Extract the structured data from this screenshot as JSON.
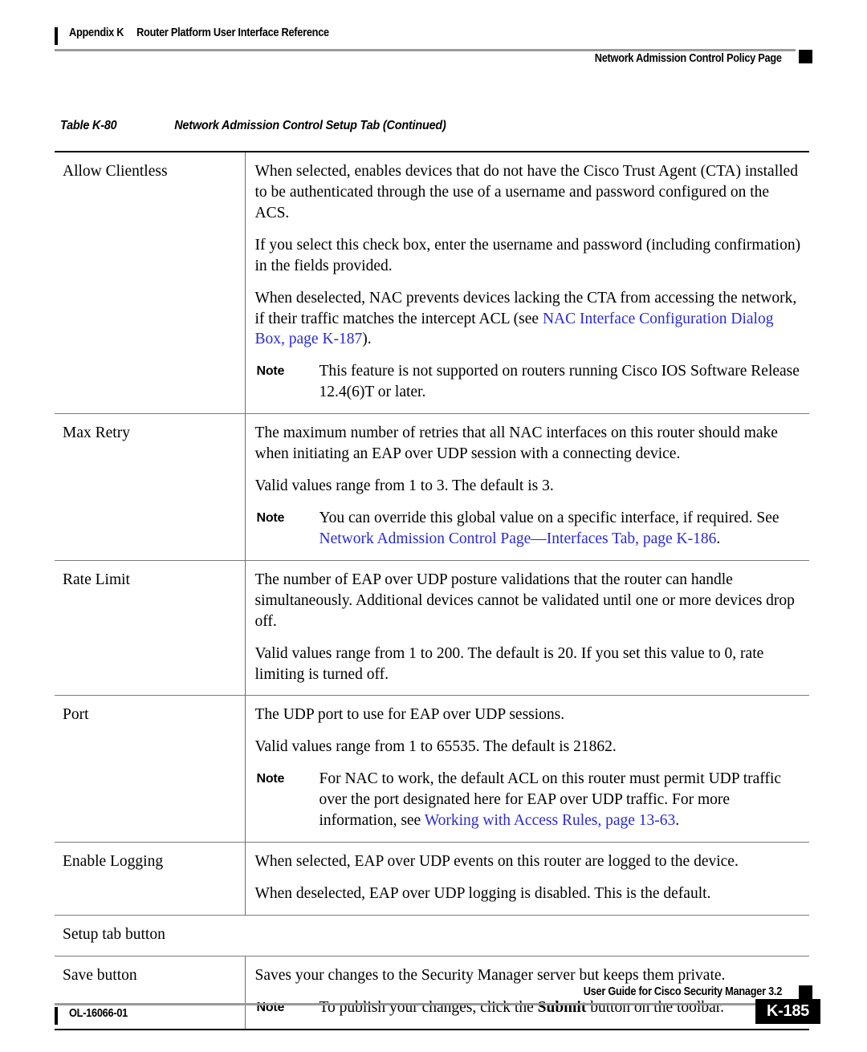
{
  "header": {
    "appendix": "Appendix K",
    "appendix_title": "Router Platform User Interface Reference",
    "section": "Network Admission Control Policy Page"
  },
  "table": {
    "caption_number": "Table K-80",
    "caption_title": "Network Admission Control Setup Tab (Continued)",
    "note_label": "Note",
    "rows": [
      {
        "name": "Allow Clientless",
        "paragraphs": [
          "When selected, enables devices that do not have the Cisco Trust Agent (CTA) installed to be authenticated through the use of a username and password configured on the ACS.",
          "If you select this check box, enter the username and password (including confirmation) in the fields provided.",
          "When deselected, NAC prevents devices lacking the CTA from accessing the network, if their traffic matches the intercept ACL (see "
        ],
        "link_text": "NAC Interface Configuration Dialog Box, page K-187",
        "link_tail": ").",
        "note": "This feature is not supported on routers running Cisco IOS Software Release 12.4(6)T or later."
      },
      {
        "name": "Max Retry",
        "paragraphs": [
          "The maximum number of retries that all NAC interfaces on this router should make when initiating an EAP over UDP session with a connecting device.",
          "Valid values range from 1 to 3. The default is 3."
        ],
        "note_lead": "You can override this global value on a specific interface, if required. See ",
        "note_link": "Network Admission Control Page—Interfaces Tab, page K-186",
        "note_tail": "."
      },
      {
        "name": "Rate Limit",
        "paragraphs": [
          "The number of EAP over UDP posture validations that the router can handle simultaneously. Additional devices cannot be validated until one or more devices drop off.",
          "Valid values range from 1 to 200. The default is 20. If you set this value to 0, rate limiting is turned off."
        ]
      },
      {
        "name": "Port",
        "paragraphs": [
          "The UDP port to use for EAP over UDP sessions.",
          "Valid values range from 1 to 65535. The default is 21862."
        ],
        "note_lead": "For NAC to work, the default ACL on this router must permit UDP traffic over the port designated here for EAP over UDP traffic. For more information, see ",
        "note_link": "Working with Access Rules, page 13-63",
        "note_tail": "."
      },
      {
        "name": "Enable Logging",
        "paragraphs": [
          "When selected, EAP over UDP events on this router are logged to the device.",
          "When deselected, EAP over UDP logging is disabled. This is the default."
        ]
      }
    ],
    "section_row": "Setup tab button",
    "save_row": {
      "name": "Save button",
      "paragraphs": [
        "Saves your changes to the Security Manager server but keeps them private."
      ],
      "note_lead": "To publish your changes, click the ",
      "note_bold": "Submit",
      "note_tail": " button on the toolbar."
    }
  },
  "footer": {
    "doc_id": "OL-16066-01",
    "guide_title": "User Guide for Cisco Security Manager 3.2",
    "page_number": "K-185"
  },
  "colors": {
    "link": "#2a2ad4",
    "rule_gray": "#9a9a9a",
    "text": "#000000"
  }
}
